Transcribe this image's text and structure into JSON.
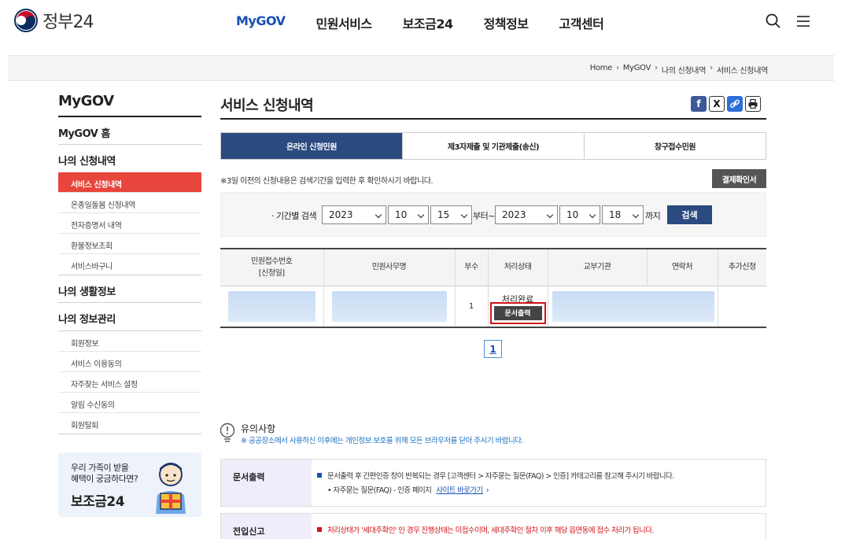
{
  "header": {
    "logo_text": "정부24",
    "nav": [
      "MyGOV",
      "민원서비스",
      "보조금24",
      "정책정보",
      "고객센터"
    ],
    "active_nav": "MyGOV"
  },
  "breadcrumb": [
    "Home",
    "MyGOV",
    "나의 신청내역",
    "서비스 신청내역"
  ],
  "sidebar": {
    "title": "MyGOV",
    "home": "MyGOV 홈",
    "sec_apply": "나의 신청내역",
    "apply_items": [
      "서비스 신청내역",
      "온종일돌봄 신청내역",
      "전자증명서 내역",
      "환불정보조회",
      "서비스바구니"
    ],
    "sec_life": "나의 생활정보",
    "sec_info": "나의 정보관리",
    "info_items": [
      "회원정보",
      "서비스 이용동의",
      "자주찾는 서비스 설정",
      "알림 수신동의",
      "회원탈퇴"
    ],
    "banner_line1": "우리 가족이 받을",
    "banner_line2": "혜택이 궁금하다면?",
    "banner_title": "보조금24"
  },
  "main": {
    "title": "서비스 신청내역",
    "tabs": [
      "온라인 신청민원",
      "제3자제출 및 기관제출(송신)",
      "창구접수민원"
    ],
    "notice": "※3일 이전의 신청내용은 검색기간을 입력한 후 확인하시기 바랍니다.",
    "receipt_button": "결제확인서",
    "search": {
      "label": "· 기간별 검색",
      "from_year": "2023",
      "from_month": "10",
      "from_day": "15",
      "from_suffix": "부터~",
      "to_year": "2023",
      "to_month": "10",
      "to_day": "18",
      "to_suffix": "까지",
      "button": "검색"
    },
    "table": {
      "headers": [
        "민원접수번호\n[신청일]",
        "민원사무명",
        "부수",
        "처리상태",
        "교부기관",
        "연락처",
        "추가신청"
      ],
      "row": {
        "copies": "1",
        "status": "처리완료",
        "print_button": "문서출력"
      }
    },
    "page": "1",
    "caution": {
      "title": "유의사항",
      "text": "※ 공공장소에서 사용하신 이후에는 개인정보 보호를 위해 모든 브라우저를 닫아 주시기 바랍니다."
    },
    "info1": {
      "head": "문서출력",
      "line1": "문서출력 후 간편인증 창이 반복되는 경우 [고객센터 > 자주묻는 질문(FAQ) > 인증] 카테고리를 참고해 주시기 바랍니다.",
      "line2": "• 자주묻는 질문(FAQ) - 인증 페이지",
      "link": "사이트 바로가기"
    },
    "info2": {
      "head": "전입신고",
      "line1": "처리상태가 '세대주확인' 인 경우 진행상태는 미접수이며, 세대주확인 절차 이후 해당 읍면동에 접수 처리가 됩니다."
    }
  }
}
